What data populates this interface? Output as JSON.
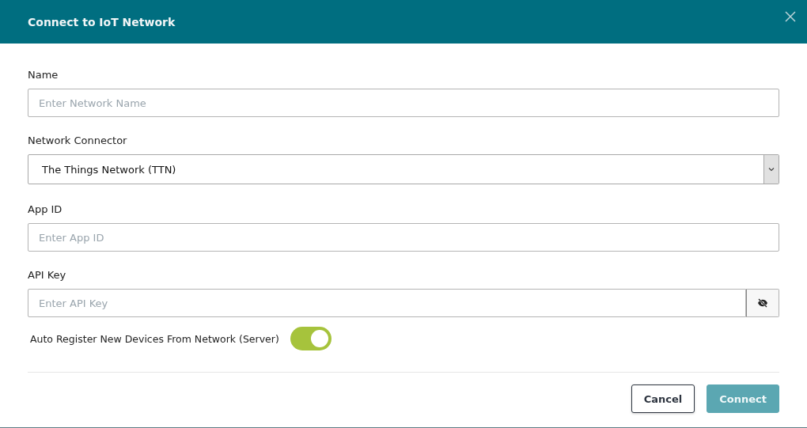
{
  "dialog": {
    "title": "Connect to IoT Network"
  },
  "fields": [
    {
      "kind": "text",
      "label": "Name",
      "placeholder": "Enter Network Name"
    },
    {
      "kind": "select",
      "label": "Network Connector",
      "value": "The Things Network (TTN)"
    },
    {
      "kind": "text",
      "label": "App ID",
      "placeholder": "Enter App ID"
    },
    {
      "kind": "secret",
      "label": "API Key",
      "placeholder": "Enter API Key"
    }
  ],
  "toggle": {
    "label": "Auto Register New Devices From Network (Server)",
    "on": true
  },
  "buttons": [
    {
      "label": "Cancel",
      "kind": "secondary",
      "disabled": false
    },
    {
      "label": "Connect",
      "kind": "primary",
      "disabled": true
    }
  ]
}
